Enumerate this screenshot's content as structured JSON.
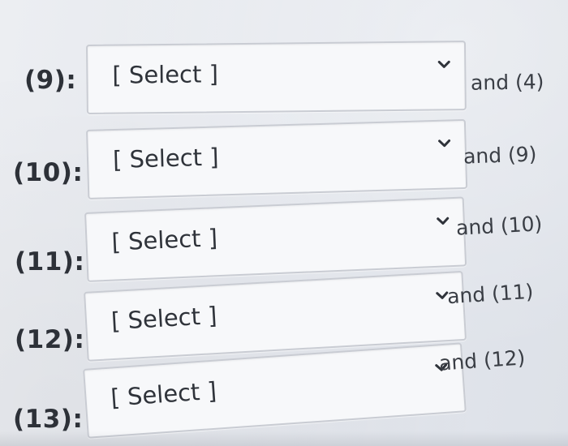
{
  "rows": [
    {
      "label": "(9):",
      "select_value": "[ Select ]",
      "suffix": "and (4)"
    },
    {
      "label": "(10):",
      "select_value": "[ Select ]",
      "suffix": "and (9)"
    },
    {
      "label": "(11):",
      "select_value": "[ Select ]",
      "suffix": "and (10)"
    },
    {
      "label": "(12):",
      "select_value": "[ Select ]",
      "suffix": "and (11)"
    },
    {
      "label": "(13):",
      "select_value": "[ Select ]",
      "suffix": "and (12)"
    }
  ],
  "icons": {
    "dropdown": "chevron-down-icon"
  },
  "colors": {
    "background": "#e5e8ee",
    "select_background": "#f7f8fa",
    "select_border": "#c9ccd3",
    "text": "#2d3138"
  }
}
